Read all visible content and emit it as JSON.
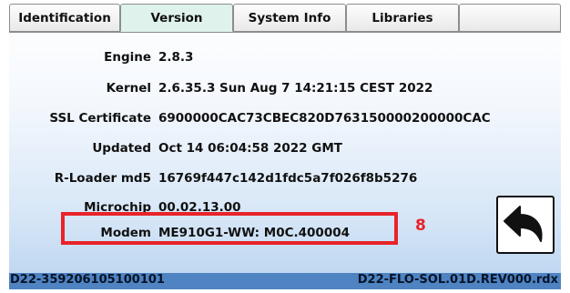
{
  "tabs": [
    {
      "label": "Identification",
      "active": false
    },
    {
      "label": "Version",
      "active": true
    },
    {
      "label": "System Info",
      "active": false
    },
    {
      "label": "Libraries",
      "active": false
    }
  ],
  "info_rows": [
    {
      "label": "Engine",
      "value": "2.8.3"
    },
    {
      "label": "Kernel",
      "value": "2.6.35.3 Sun Aug 7 14:21:15 CEST 2022"
    },
    {
      "label": "SSL Certificate",
      "value": "6900000CAC73CBEC820D763150000200000CAC"
    },
    {
      "label": "Updated",
      "value": "Oct 14 06:04:58 2022 GMT"
    },
    {
      "label": "R-Loader md5",
      "value": "16769f447c142d1fdc5a7f026f8b5276"
    },
    {
      "label": "Microchip",
      "value": "00.02.13.00"
    },
    {
      "label": "Modem",
      "value": "ME910G1-WW: M0C.400004"
    }
  ],
  "annotation": {
    "number": "8",
    "color": "#e8232a"
  },
  "back_button": {
    "icon": "back-arrow-icon"
  },
  "status_bar": {
    "left": "D22-359206105100101",
    "right": "D22-FLO-SOL.01D.REV000.rdx",
    "color": "#4f83c2"
  },
  "colors": {
    "active_tab": "#dff2ec",
    "highlight": "#e8232a"
  }
}
